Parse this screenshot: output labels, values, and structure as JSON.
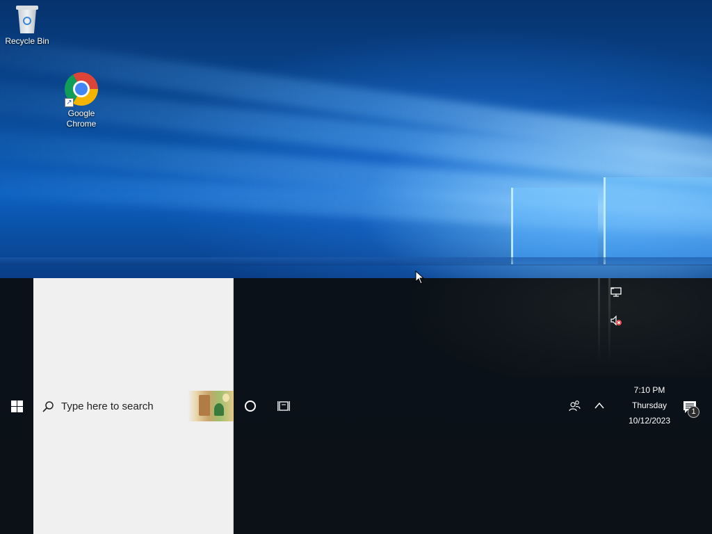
{
  "desktop": {
    "icons": [
      {
        "label": "Recycle Bin",
        "icon": "recycle-bin-icon"
      },
      {
        "label": "Google\nChrome",
        "icon": "chrome-icon"
      }
    ]
  },
  "taskbar": {
    "start_icon": "windows-logo-icon",
    "search": {
      "placeholder": "Type here to search",
      "icon": "search-icon"
    },
    "cortana_icon": "cortana-circle-icon",
    "taskview_icon": "task-view-icon",
    "people_icon": "people-icon",
    "hidden_icons_icon": "chevron-up-icon",
    "overflow_tray": {
      "icons": [
        "network-icon",
        "volume-muted-icon"
      ]
    },
    "clock": {
      "time": "7:10 PM",
      "day": "Thursday",
      "date": "10/12/2023"
    },
    "notifications": {
      "icon": "action-center-icon",
      "count": "1"
    }
  },
  "colors": {
    "taskbar_bg": "#0b1117",
    "start_panel_bg": "#f0f0f0",
    "wallpaper_blue": "#0a4d9c"
  }
}
